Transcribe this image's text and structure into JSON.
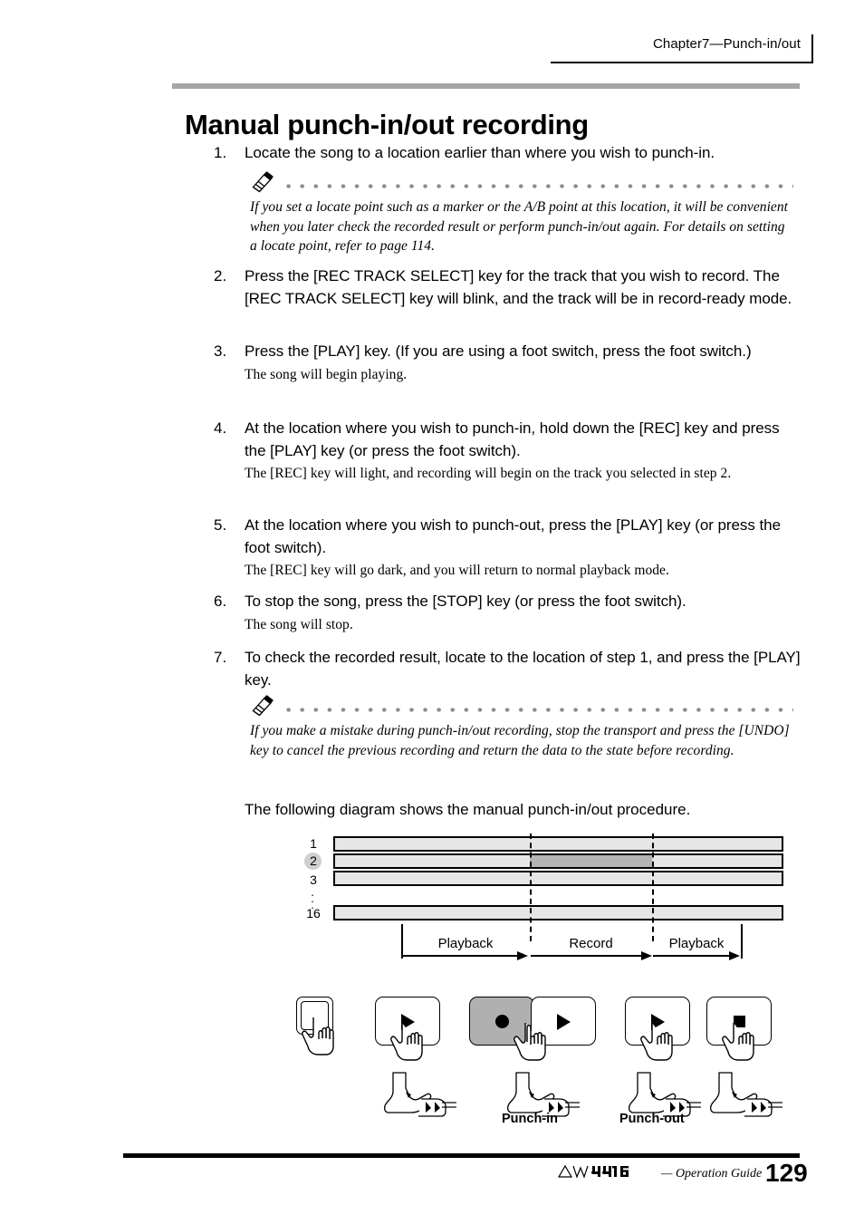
{
  "header": {
    "chapter": "Chapter7—Punch-in/out"
  },
  "title": "Manual punch-in/out recording",
  "steps": [
    {
      "num": "1.",
      "text": "Locate the song to a location earlier than where you wish to punch-in."
    },
    {
      "num": "2.",
      "text": "Press the [REC TRACK SELECT] key for the track that you wish to record. The [REC TRACK SELECT] key will blink, and the track will be in record-ready mode."
    },
    {
      "num": "3.",
      "text": "Press the [PLAY] key. (If you are using a foot switch, press the foot switch.)",
      "sub": "The song will begin playing."
    },
    {
      "num": "4.",
      "text": "At the location where you wish to punch-in, hold down the [REC] key and press the [PLAY] key (or press the foot switch).",
      "sub": "The [REC] key will light, and recording will begin on the track you selected in step 2."
    },
    {
      "num": "5.",
      "text": "At the location where you wish to punch-out, press the [PLAY] key (or press the foot switch).",
      "sub": "The [REC] key will go dark, and you will return to normal playback mode."
    },
    {
      "num": "6.",
      "text": "To stop the song, press the [STOP] key (or press the foot switch).",
      "sub": "The song will stop."
    },
    {
      "num": "7.",
      "text": "To check the recorded result, locate to the location of step 1, and press the [PLAY] key."
    }
  ],
  "notes": [
    {
      "text": "If you set a locate point such as a marker or the A/B point at this location, it will be convenient when you later check the recorded result or perform punch-in/out again. For details on setting a locate point, refer to page 114."
    },
    {
      "text": "If you make a mistake during punch-in/out recording, stop the transport and press the [UNDO] key to cancel the previous recording and return the data to the state before recording."
    }
  ],
  "diagram_intro": "The following diagram shows the manual punch-in/out procedure.",
  "diagram": {
    "track_labels": [
      "1",
      "2",
      "3",
      "16"
    ],
    "highlighted_track": "2",
    "vertical_ellipsis": "⋮",
    "timeline_segments": [
      "Playback",
      "Record",
      "Playback"
    ],
    "punch_in_label": "Punch-in",
    "punch_out_label": "Punch-out",
    "keys": [
      {
        "name": "rec-track-select-key",
        "glyph": "blank",
        "state": "normal"
      },
      {
        "name": "play-key",
        "glyph": "play",
        "state": "normal"
      },
      {
        "name": "rec-key",
        "glyph": "record",
        "state": "shaded"
      },
      {
        "name": "play-key-punch-in",
        "glyph": "play",
        "state": "normal"
      },
      {
        "name": "play-key-punch-out",
        "glyph": "play",
        "state": "normal"
      },
      {
        "name": "stop-key",
        "glyph": "stop",
        "state": "normal"
      }
    ],
    "colors": {
      "track_fill": "#e6e6e6",
      "record_fill": "#b4b4b4",
      "key_shaded": "#b0b0b0",
      "title_rule": "#a6a6a6",
      "dot_leader": "#8c8c8c"
    }
  },
  "footer": {
    "product": "AW4416",
    "subtitle": "— Operation Guide",
    "page_number": "129"
  }
}
